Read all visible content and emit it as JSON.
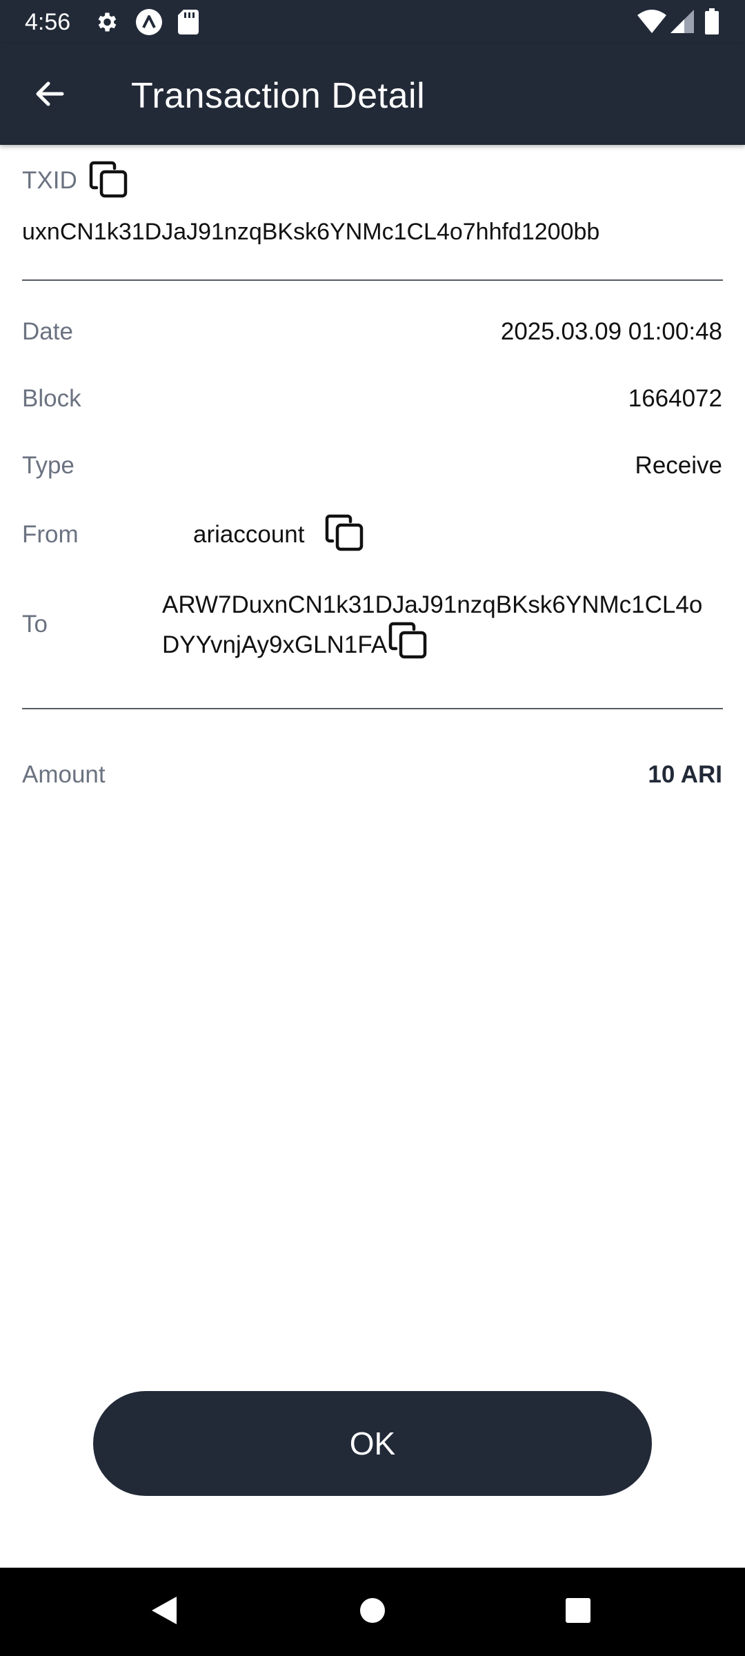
{
  "status_bar": {
    "time": "4:56",
    "icons": [
      "settings-icon",
      "app-a-icon",
      "sd-card-icon",
      "wifi-icon",
      "signal-icon",
      "battery-icon"
    ]
  },
  "app_bar": {
    "title": "Transaction Detail",
    "back_icon": "arrow-back-icon"
  },
  "txid": {
    "label": "TXID",
    "value": "uxnCN1k31DJaJ91nzqBKsk6YNMc1CL4o7hhfd1200bb"
  },
  "details": {
    "date_label": "Date",
    "date_value": "2025.03.09 01:00:48",
    "block_label": "Block",
    "block_value": "1664072",
    "type_label": "Type",
    "type_value": "Receive",
    "from_label": "From",
    "from_value": "ariaccount",
    "to_label": "To",
    "to_value_line1": "ARW7DuxnCN1k31DJaJ91nzqBKsk6YNMc1CL4o",
    "to_value_line2": "DYYvnjAy9xGLN1FA"
  },
  "amount": {
    "label": "Amount",
    "value": "10 ARI"
  },
  "ok_button": {
    "label": "OK"
  },
  "nav_bar": {
    "icons": [
      "back-triangle-icon",
      "home-circle-icon",
      "recents-square-icon"
    ]
  },
  "colors": {
    "header_bg": "#222a38",
    "label_gray": "#6b7280",
    "divider": "#555b63"
  }
}
